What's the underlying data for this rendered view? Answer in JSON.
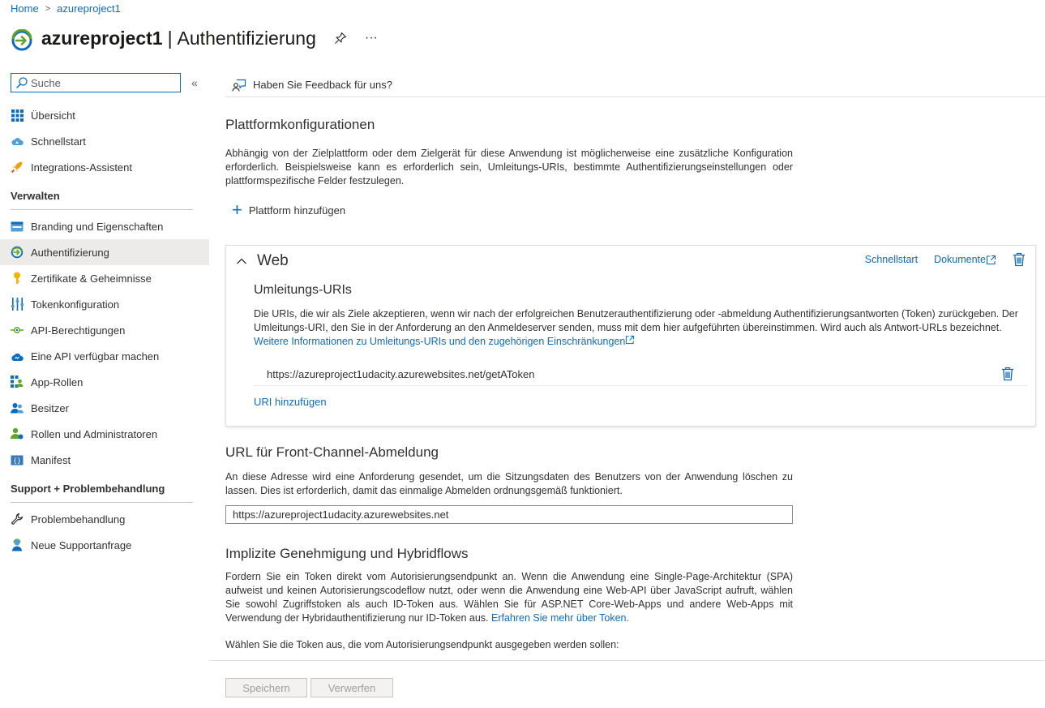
{
  "breadcrumb": {
    "home": "Home",
    "current": "azureproject1"
  },
  "header": {
    "app_name": "azureproject1",
    "separator": "|",
    "page": "Authentifizierung",
    "more": "···"
  },
  "search": {
    "placeholder": "Suche",
    "value": ""
  },
  "sidebar": {
    "items_top": [
      {
        "label": "Übersicht",
        "icon": "grid-icon"
      },
      {
        "label": "Schnellstart",
        "icon": "cloud-quickstart-icon"
      },
      {
        "label": "Integrations-Assistent",
        "icon": "rocket-icon"
      }
    ],
    "section_manage": "Verwalten",
    "items_manage": [
      {
        "label": "Branding und Eigenschaften",
        "icon": "branding-icon"
      },
      {
        "label": "Authentifizierung",
        "icon": "auth-icon",
        "active": true
      },
      {
        "label": "Zertifikate & Geheimnisse",
        "icon": "key-icon"
      },
      {
        "label": "Tokenkonfiguration",
        "icon": "sliders-icon"
      },
      {
        "label": "API-Berechtigungen",
        "icon": "api-permissions-icon"
      },
      {
        "label": "Eine API verfügbar machen",
        "icon": "cloud-api-icon"
      },
      {
        "label": "App-Rollen",
        "icon": "app-roles-icon"
      },
      {
        "label": "Besitzer",
        "icon": "owners-icon"
      },
      {
        "label": "Rollen und Administratoren",
        "icon": "roles-admins-icon"
      },
      {
        "label": "Manifest",
        "icon": "manifest-icon"
      }
    ],
    "section_support": "Support + Problembehandlung",
    "items_support": [
      {
        "label": "Problembehandlung",
        "icon": "wrench-icon"
      },
      {
        "label": "Neue Supportanfrage",
        "icon": "support-person-icon"
      }
    ]
  },
  "toolbar": {
    "feedback": "Haben Sie Feedback für uns?"
  },
  "platform": {
    "title": "Plattformkonfigurationen",
    "description": "Abhängig von der Zielplattform oder dem Zielgerät für diese Anwendung ist möglicherweise eine zusätzliche Konfiguration erforderlich. Beispielsweise kann es erforderlich sein, Umleitungs-URIs, bestimmte Authentifizierungseinstellungen oder plattformspezifische Felder festzulegen.",
    "add_label": "Plattform hinzufügen"
  },
  "web_card": {
    "title": "Web",
    "quickstart": "Schnellstart",
    "docs": "Dokumente",
    "redirect_title": "Umleitungs-URIs",
    "redirect_desc": "Die URIs, die wir als Ziele akzeptieren, wenn wir nach der erfolgreichen Benutzerauthentifizierung oder -abmeldung Authentifizierungsantworten (Token) zurückgeben. Der Umleitungs-URI, den Sie in der Anforderung an den Anmeldeserver senden, muss mit dem hier aufgeführten übereinstimmen. Wird auch als Antwort-URLs bezeichnet.",
    "redirect_link": "Weitere Informationen zu Umleitungs-URIs und den zugehörigen Einschränkungen",
    "uri": "https://azureproject1udacity.azurewebsites.net/getAToken",
    "add_uri": "URI hinzufügen"
  },
  "front_channel": {
    "title": "URL für Front-Channel-Abmeldung",
    "description": "An diese Adresse wird eine Anforderung gesendet, um die Sitzungsdaten des Benutzers von der Anwendung löschen zu lassen. Dies ist erforderlich, damit das einmalige Abmelden ordnungsgemäß funktioniert.",
    "value": "https://azureproject1udacity.azurewebsites.net"
  },
  "implicit": {
    "title": "Implizite Genehmigung und Hybridflows",
    "description": "Fordern Sie ein Token direkt vom Autorisierungsendpunkt an. Wenn die Anwendung eine Single-Page-Architektur (SPA) aufweist und keinen Autorisierungscodeflow nutzt, oder wenn die Anwendung eine Web-API über JavaScript aufruft, wählen Sie sowohl Zugriffstoken als auch ID-Token aus. Wählen Sie für ASP.NET Core-Web-Apps und andere Web-Apps mit Verwendung der Hybridauthentifizierung nur ID-Token aus.",
    "link": "Erfahren Sie mehr über Token.",
    "token_question": "Wählen Sie die Token aus, die vom Autorisierungsendpunkt ausgegeben werden sollen:"
  },
  "footer": {
    "save": "Speichern",
    "discard": "Verwerfen"
  },
  "colors": {
    "accent": "#0f6cbd",
    "active_bg": "#edebe9"
  }
}
